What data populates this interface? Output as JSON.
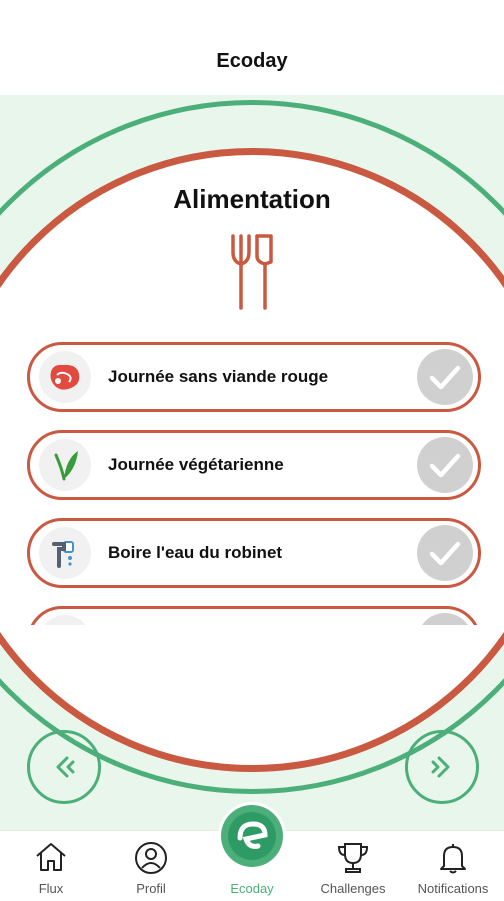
{
  "header": {
    "title": "Ecoday"
  },
  "category": {
    "title": "Alimentation",
    "icon": "cutlery-icon"
  },
  "actions": [
    {
      "label": "Journée sans viande rouge",
      "icon": "steak-icon"
    },
    {
      "label": "Journée végétarienne",
      "icon": "leaf-icon"
    },
    {
      "label": "Boire l'eau du robinet",
      "icon": "tap-water-icon"
    }
  ],
  "tabs": [
    {
      "label": "Flux",
      "icon": "home-icon"
    },
    {
      "label": "Profil",
      "icon": "profile-icon"
    },
    {
      "label": "Ecoday",
      "icon": "ecoday-logo-icon"
    },
    {
      "label": "Challenges",
      "icon": "trophy-icon"
    },
    {
      "label": "Notifications",
      "icon": "bell-icon"
    }
  ],
  "colors": {
    "accent_green": "#4caf7a",
    "category_red": "#c95940",
    "background_mint": "#e8f6ec",
    "check_grey": "#d0d0d0"
  }
}
